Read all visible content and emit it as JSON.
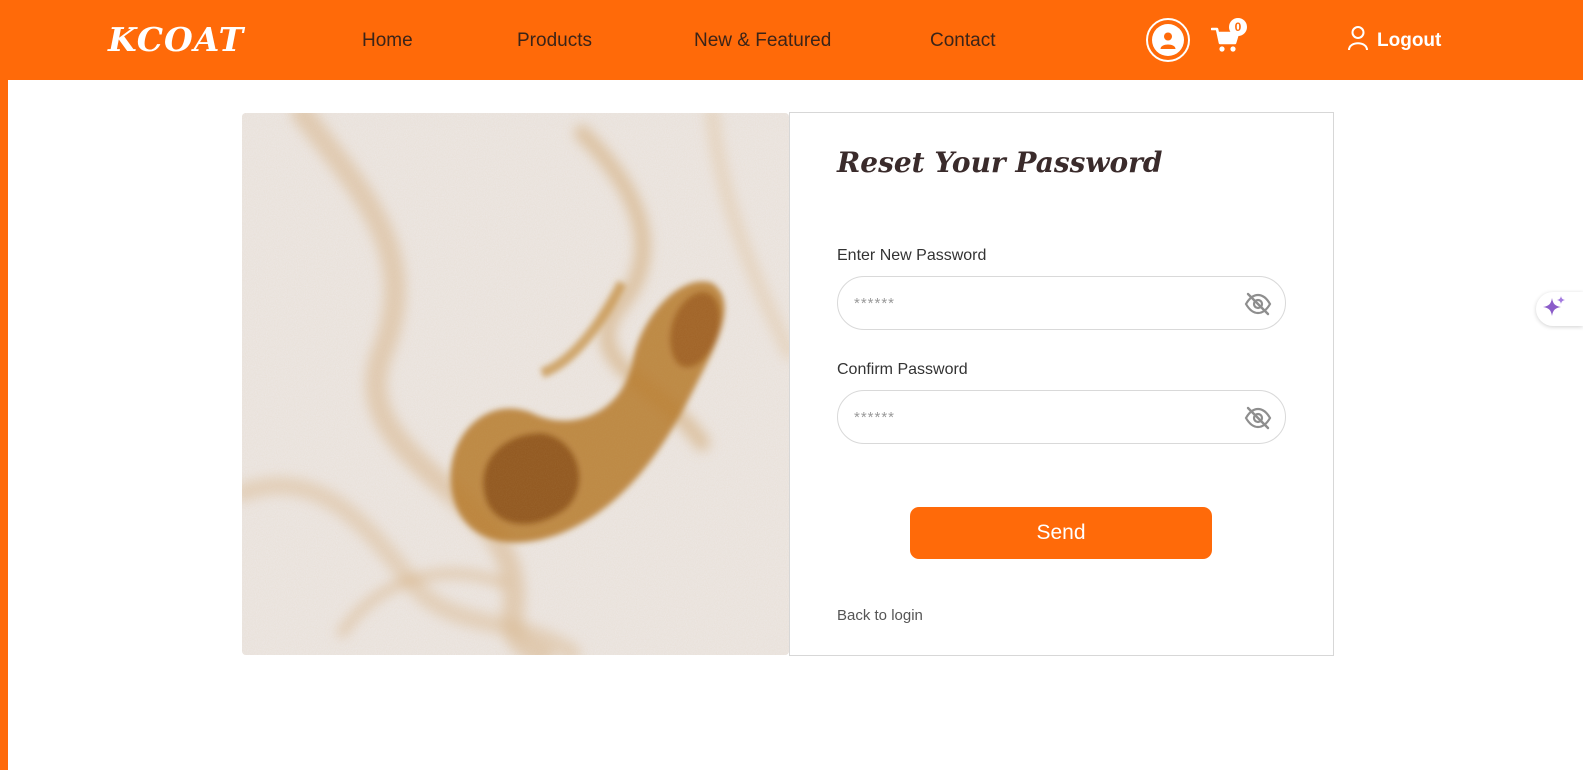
{
  "brand": {
    "logo": "KCOAT",
    "accent": "#ff6a09"
  },
  "nav": {
    "links": [
      {
        "label": "Home"
      },
      {
        "label": "Products"
      },
      {
        "label": "New & Featured"
      },
      {
        "label": "Contact"
      }
    ],
    "cart_count": "0",
    "logout_label": "Logout"
  },
  "form": {
    "title": "Reset Your Password",
    "new_password": {
      "label": "Enter New Password",
      "placeholder": "******"
    },
    "confirm_password": {
      "label": "Confirm Password",
      "placeholder": "******"
    },
    "submit_label": "Send",
    "back_link": "Back to login"
  },
  "icons": {
    "user": "user-circle-icon",
    "cart": "shopping-cart-icon",
    "logout": "user-outline-icon",
    "eye": "eye-slash-icon",
    "assistant": "sparkle-icon"
  }
}
